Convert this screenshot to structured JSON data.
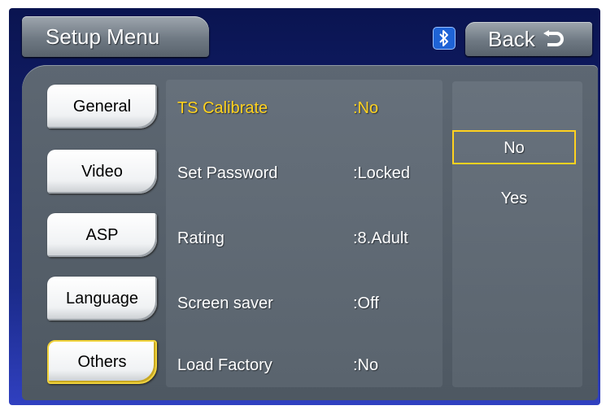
{
  "header": {
    "title": "Setup Menu",
    "back_label": "Back"
  },
  "icons": {
    "bluetooth": "bluetooth-icon",
    "back": "return-arrow-icon"
  },
  "sidebar": {
    "items": [
      {
        "label": "General"
      },
      {
        "label": "Video"
      },
      {
        "label": "ASP"
      },
      {
        "label": "Language"
      },
      {
        "label": "Others",
        "active": true
      }
    ]
  },
  "settings": {
    "rows": [
      {
        "label": "TS Calibrate",
        "value": ":No",
        "selected": true
      },
      {
        "label": "Set Password",
        "value": ":Locked"
      },
      {
        "label": "Rating",
        "value": ":8.Adult"
      },
      {
        "label": "Screen saver",
        "value": ":Off"
      },
      {
        "label": "Load Factory",
        "value": ":No"
      }
    ]
  },
  "options": {
    "items": [
      {
        "label": "No",
        "highlighted": true
      },
      {
        "label": "Yes"
      }
    ]
  },
  "colors": {
    "accent": "#ffd21f",
    "panel": "#5d6772",
    "background": "#0a1450"
  }
}
